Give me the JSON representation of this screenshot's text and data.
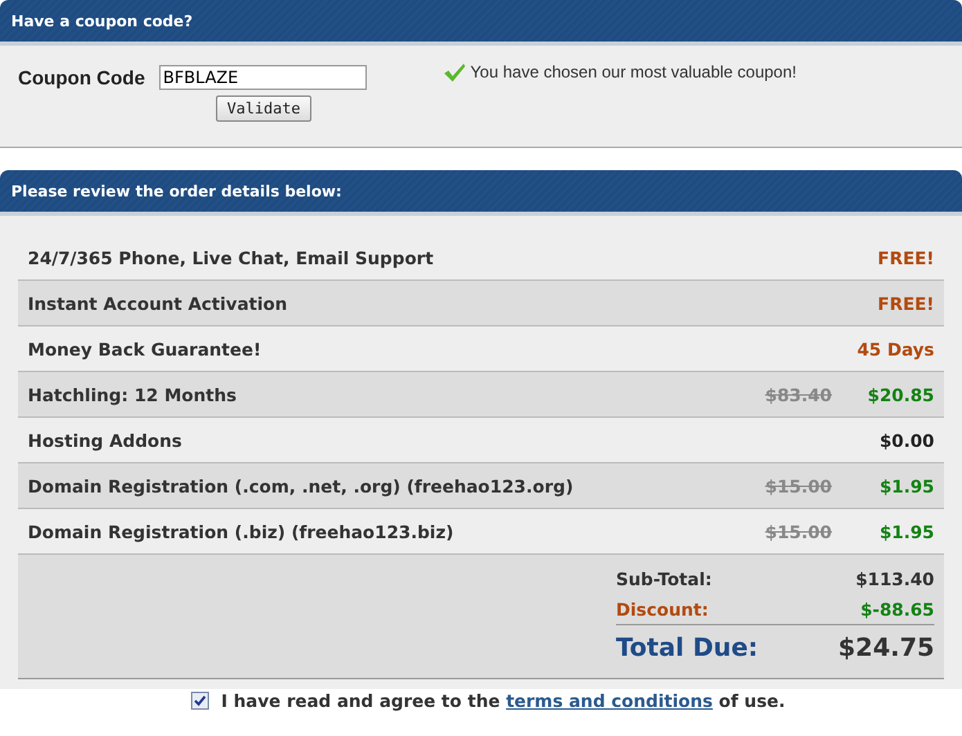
{
  "coupon_section": {
    "title": "Have a coupon code?",
    "label": "Coupon Code",
    "value": "BFBLAZE",
    "button": "Validate",
    "message": "You have chosen our most valuable coupon!"
  },
  "order_section": {
    "title": "Please review the order details below:",
    "items": [
      {
        "name": "24/7/365 Phone, Live Chat, Email Support",
        "price": "FREE!",
        "kind": "free"
      },
      {
        "name": "Instant Account Activation",
        "price": "FREE!",
        "kind": "free"
      },
      {
        "name": "Money Back Guarantee!",
        "price": "45 Days",
        "kind": "free"
      },
      {
        "name": "Hatchling: 12 Months",
        "old_price": "$83.40",
        "price": "$20.85",
        "kind": "discounted"
      },
      {
        "name": "Hosting Addons",
        "price": "$0.00",
        "kind": "plain"
      },
      {
        "name": "Domain Registration (.com, .net, .org) (freehao123.org)",
        "old_price": "$15.00",
        "price": "$1.95",
        "kind": "discounted"
      },
      {
        "name": "Domain Registration (.biz) (freehao123.biz)",
        "old_price": "$15.00",
        "price": "$1.95",
        "kind": "discounted"
      }
    ],
    "subtotal_label": "Sub-Total:",
    "subtotal": "$113.40",
    "discount_label": "Discount:",
    "discount": "$-88.65",
    "total_label": "Total Due:",
    "total": "$24.75",
    "agree": {
      "checked": true,
      "text_before": "I have read and agree to the",
      "link": "terms and conditions",
      "text_after": "of use."
    }
  }
}
